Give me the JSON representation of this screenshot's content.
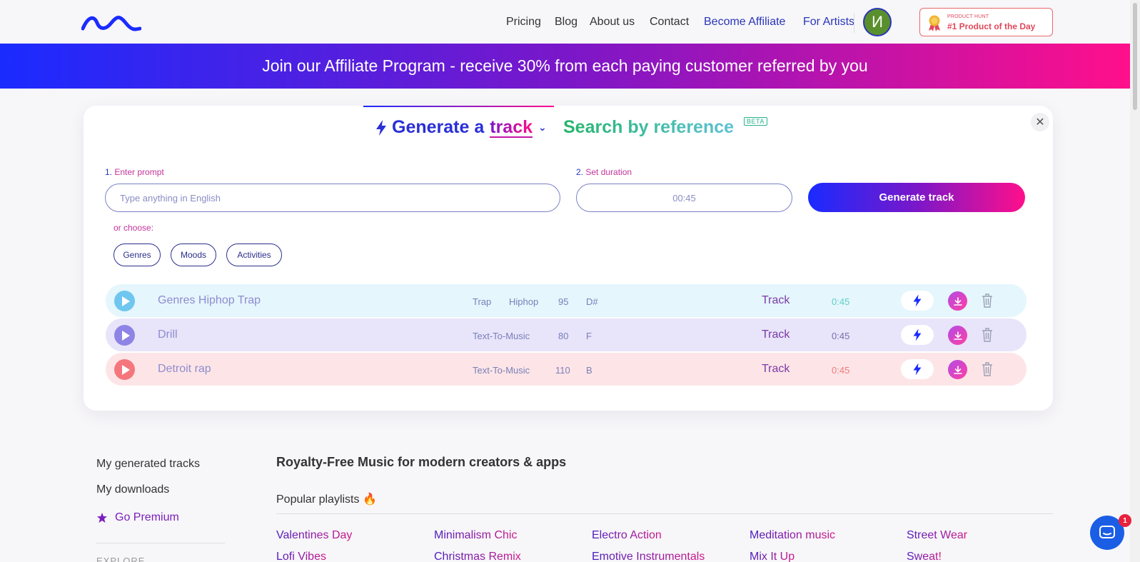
{
  "header": {
    "nav": [
      "Pricing",
      "Blog",
      "About us",
      "Contact",
      "Become Affiliate",
      "For Artists"
    ],
    "avatar_initial": "И",
    "product_hunt": {
      "small": "PRODUCT HUNT",
      "big": "#1 Product of the Day"
    }
  },
  "banner": {
    "text": "Join our Affiliate Program - receive 30% from each paying customer referred by you"
  },
  "generator": {
    "tab_prefix": "Generate a",
    "tab_highlight": "track",
    "tab_search": "Search by reference",
    "beta": "BETA",
    "close": "✕",
    "prompt_label_num": "1.",
    "prompt_label": "Enter prompt",
    "prompt_placeholder": "Type anything in English",
    "duration_label_num": "2.",
    "duration_label": "Set duration",
    "duration_value": "00:45",
    "generate_button": "Generate track",
    "or_choose": "or choose:",
    "chips": [
      "Genres",
      "Moods",
      "Activities"
    ]
  },
  "tracks": [
    {
      "name": "Genres Hiphop Trap",
      "tags": [
        "Trap",
        "Hiphop"
      ],
      "bpm": "95",
      "key": "D#",
      "type": "Track",
      "duration": "0:45",
      "bg": "#e5f6fd",
      "play_color": "#6fc6ef",
      "dur_color": "#5ed0c6"
    },
    {
      "name": "Drill",
      "tags": [
        "Text-To-Music"
      ],
      "bpm": "80",
      "key": "F",
      "type": "Track",
      "duration": "0:45",
      "bg": "#e8e4fa",
      "play_color": "#8e84e6",
      "dur_color": "#7a6fa8"
    },
    {
      "name": "Detroit rap",
      "tags": [
        "Text-To-Music"
      ],
      "bpm": "110",
      "key": "B",
      "type": "Track",
      "duration": "0:45",
      "bg": "#fde5e7",
      "play_color": "#f5767c",
      "dur_color": "#ee7a7a"
    }
  ],
  "sidebar": {
    "links": [
      "My generated tracks",
      "My downloads"
    ],
    "premium": "Go Premium",
    "explore": "EXPLORE"
  },
  "content": {
    "title": "Royalty-Free Music for modern creators & apps",
    "popular": "Popular playlists 🔥",
    "playlists": [
      [
        "Valentines Day",
        "Lofi Vibes"
      ],
      [
        "Minimalism Chic",
        "Christmas Remix"
      ],
      [
        "Electro Action",
        "Emotive Instrumentals"
      ],
      [
        "Meditation music",
        "Mix It Up"
      ],
      [
        "Street Wear",
        "Sweat!"
      ]
    ]
  },
  "chat": {
    "badge": "1"
  },
  "colors": {
    "brand_blue": "#1a2bff",
    "brand_pink": "#ff0f8b",
    "nav_blue": "#2a36b8"
  }
}
